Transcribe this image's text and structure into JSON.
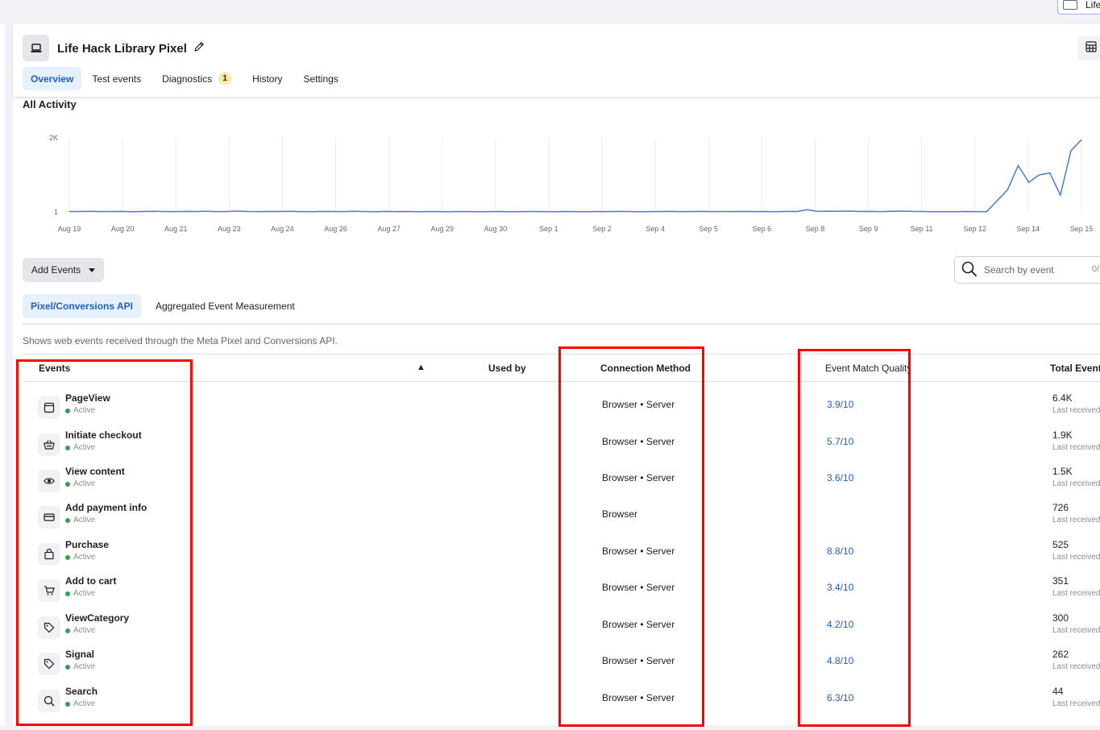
{
  "top_chip": {
    "label": "Life"
  },
  "header": {
    "title": "Life Hack Library Pixel",
    "tabs": [
      {
        "label": "Overview",
        "active": true
      },
      {
        "label": "Test events"
      },
      {
        "label": "Diagnostics",
        "badge": "1"
      },
      {
        "label": "History"
      },
      {
        "label": "Settings"
      }
    ]
  },
  "activity": {
    "title": "All Activity"
  },
  "chart_data": {
    "type": "line",
    "title": "All Activity",
    "y_ticks": [
      "2K",
      "1"
    ],
    "x_ticks": [
      "Aug 19",
      "Aug 20",
      "Aug 21",
      "Aug 23",
      "Aug 24",
      "Aug 26",
      "Aug 27",
      "Aug 29",
      "Aug 30",
      "Sep 1",
      "Sep 2",
      "Sep 4",
      "Sep 5",
      "Sep 6",
      "Sep 8",
      "Sep 9",
      "Sep 11",
      "Sep 12",
      "Sep 14",
      "Sep 15"
    ],
    "ylim": [
      1,
      2000
    ],
    "grid": "vertical",
    "color": "#4a7bd4",
    "values": [
      12,
      12,
      18,
      10,
      12,
      14,
      8,
      12,
      18,
      12,
      10,
      14,
      12,
      18,
      10,
      12,
      22,
      12,
      10,
      14,
      12,
      18,
      10,
      8,
      14,
      12,
      10,
      18,
      12,
      8,
      14,
      10,
      12,
      8,
      12,
      10,
      8,
      12,
      10,
      8,
      10,
      12,
      8,
      10,
      12,
      10,
      8,
      12,
      10,
      8,
      12,
      10,
      14,
      12,
      8,
      10,
      12,
      14,
      10,
      12,
      14,
      10,
      12,
      10,
      14,
      10,
      12,
      8,
      14,
      12,
      60,
      14,
      20,
      18,
      22,
      12,
      14,
      10,
      18,
      22,
      14,
      12,
      8,
      10,
      8,
      12,
      10,
      8,
      300,
      600,
      1250,
      800,
      1000,
      1050,
      450,
      1650,
      1950
    ]
  },
  "controls": {
    "add_events": "Add Events",
    "search_placeholder": "Search by event",
    "search_count": "0/"
  },
  "subtabs": [
    {
      "label": "Pixel/Conversions API",
      "active": true
    },
    {
      "label": "Aggregated Event Measurement"
    }
  ],
  "description": "Shows web events received through the Meta Pixel and Conversions API.",
  "table": {
    "headers": {
      "events": "Events",
      "warning": "▲",
      "used_by": "Used by",
      "connection_method": "Connection Method",
      "emq": "Event Match Quality",
      "total": "Total Events"
    },
    "rows": [
      {
        "icon": "browser-window-icon",
        "name": "PageView",
        "status": "Active",
        "method": "Browser • Server",
        "emq": "3.9/10",
        "total": "6.4K",
        "last": "Last received"
      },
      {
        "icon": "basket-icon",
        "name": "Initiate checkout",
        "status": "Active",
        "method": "Browser • Server",
        "emq": "5.7/10",
        "total": "1.9K",
        "last": "Last received"
      },
      {
        "icon": "eye-icon",
        "name": "View content",
        "status": "Active",
        "method": "Browser • Server",
        "emq": "3.6/10",
        "total": "1.5K",
        "last": "Last received"
      },
      {
        "icon": "credit-card-icon",
        "name": "Add payment info",
        "status": "Active",
        "method": "Browser",
        "emq": "",
        "total": "726",
        "last": "Last received"
      },
      {
        "icon": "shopping-bag-icon",
        "name": "Purchase",
        "status": "Active",
        "method": "Browser • Server",
        "emq": "8.8/10",
        "total": "525",
        "last": "Last received"
      },
      {
        "icon": "cart-icon",
        "name": "Add to cart",
        "status": "Active",
        "method": "Browser • Server",
        "emq": "3.4/10",
        "total": "351",
        "last": "Last received"
      },
      {
        "icon": "tag-icon",
        "name": "ViewCategory",
        "status": "Active",
        "method": "Browser • Server",
        "emq": "4.2/10",
        "total": "300",
        "last": "Last received"
      },
      {
        "icon": "tag-icon",
        "name": "Signal",
        "status": "Active",
        "method": "Browser • Server",
        "emq": "4.8/10",
        "total": "262",
        "last": "Last received"
      },
      {
        "icon": "search-icon",
        "name": "Search",
        "status": "Active",
        "method": "Browser • Server",
        "emq": "6.3/10",
        "total": "44",
        "last": "Last received"
      }
    ]
  },
  "annotation_color": "#ff0000"
}
